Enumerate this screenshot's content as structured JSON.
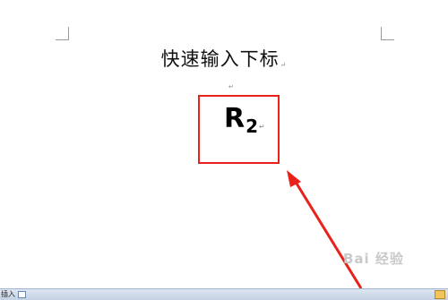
{
  "document": {
    "title": "快速输入下标",
    "formula_base": "R",
    "formula_subscript": "2",
    "paragraph_mark": "↵"
  },
  "watermark": {
    "text": "Bai 经验"
  },
  "statusbar": {
    "mode_text": "插入"
  },
  "colors": {
    "highlight": "#e8221a"
  }
}
